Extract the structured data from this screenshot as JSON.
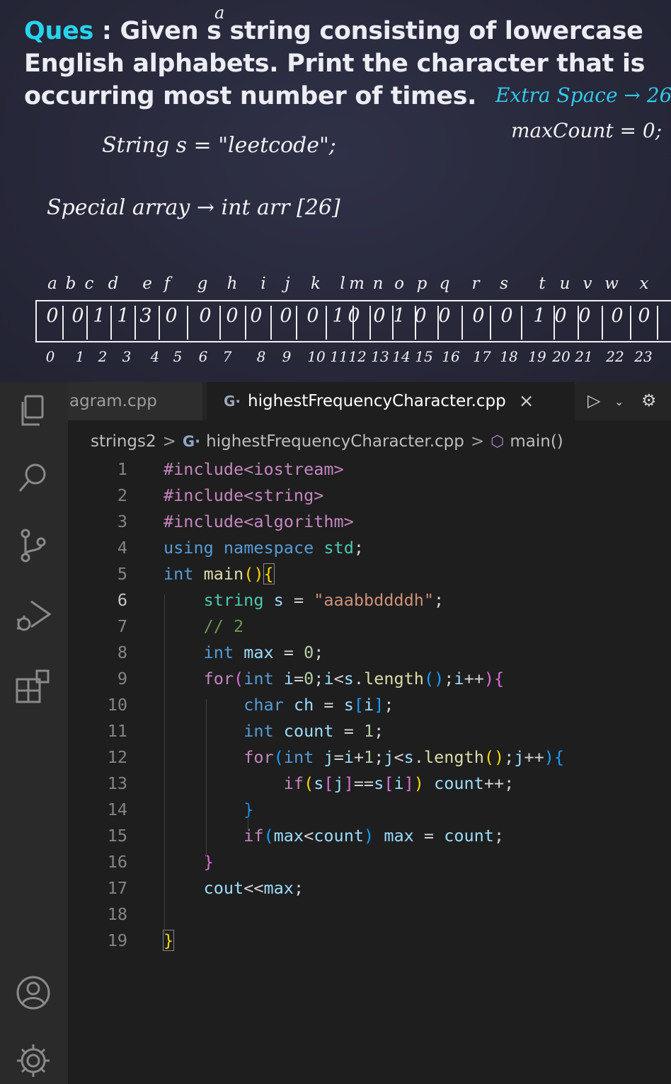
{
  "board": {
    "question_label": "Ques",
    "question_line1": " : Given ",
    "question_mark_s": "s",
    "question_line1b": " string",
    "question_line1c": " consisting of lowercase",
    "question_line2": "English alphabets. Print the character that is",
    "question_line3": "occurring most number of times.",
    "hand_a": "a",
    "extra_space": "Extra  Space → 26",
    "max_count": "maxCount  = 0;",
    "string_decl": "String  s  =  \"leetcode\";",
    "special_array": "Special  array  →  int arr [26]",
    "letters": [
      "a",
      "b",
      "c",
      "d",
      "e",
      "f",
      "g",
      "h",
      "i",
      "j",
      "k",
      "l",
      "m",
      "n",
      "o",
      "p",
      "q",
      "r",
      "s",
      "t",
      "u",
      "v",
      "w",
      "x"
    ],
    "cells": [
      "0",
      "0",
      "1",
      "1",
      "3",
      "0",
      "0",
      "0",
      "0",
      "0",
      "0",
      "1",
      "0",
      "0",
      "1",
      "0",
      "0",
      "0",
      "0",
      "1",
      "0",
      "0",
      "0",
      "0"
    ],
    "indices": [
      "0",
      "1",
      "2",
      "3",
      "4",
      "5",
      "6",
      "7",
      "8",
      "9",
      "10",
      "11",
      "12",
      "13",
      "14",
      "15",
      "16",
      "17",
      "18",
      "19",
      "20",
      "21",
      "22",
      "23"
    ]
  },
  "editor": {
    "tabs": [
      {
        "label": "agram.cpp"
      },
      {
        "label": "highestFrequencyCharacter.cpp",
        "close": "×"
      }
    ],
    "breadcrumb": {
      "folder": "strings2",
      "file": "highestFrequencyCharacter.cpp",
      "symbol": "main()"
    },
    "line_numbers": [
      "1",
      "2",
      "3",
      "4",
      "5",
      "6",
      "7",
      "8",
      "9",
      "10",
      "11",
      "12",
      "13",
      "14",
      "15",
      "16",
      "17",
      "18",
      "19"
    ]
  }
}
